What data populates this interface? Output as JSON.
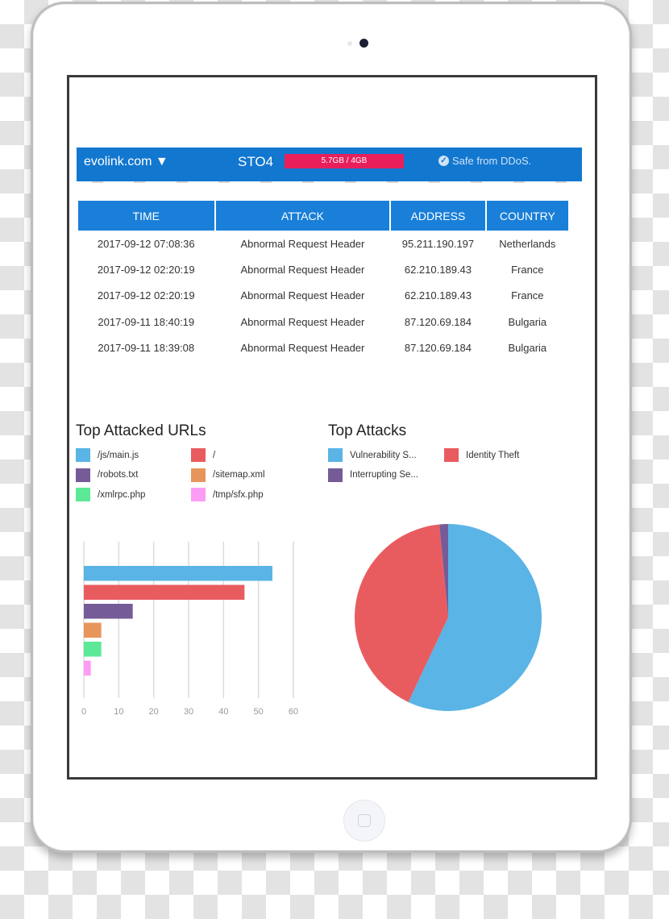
{
  "header": {
    "domain": "evolink.com ▼",
    "server": "STO4",
    "usage": "5.7GB / 4GB",
    "usage_fraction": 1.425,
    "status": "Safe from DDoS.",
    "status_icon": "check-circle-icon"
  },
  "attack_table": {
    "columns": [
      "TIME",
      "ATTACK",
      "ADDRESS",
      "COUNTRY"
    ],
    "rows": [
      [
        "2017-09-12 07:08:36",
        "Abnormal Request Header",
        "95.211.190.197",
        "Netherlands"
      ],
      [
        "2017-09-12 02:20:19",
        "Abnormal Request Header",
        "62.210.189.43",
        "France"
      ],
      [
        "2017-09-12 02:20:19",
        "Abnormal Request Header",
        "62.210.189.43",
        "France"
      ],
      [
        "2017-09-11 18:40:19",
        "Abnormal Request Header",
        "87.120.69.184",
        "Bulgaria"
      ],
      [
        "2017-09-11 18:39:08",
        "Abnormal Request Header",
        "87.120.69.184",
        "Bulgaria"
      ]
    ]
  },
  "colors": {
    "header_bg": "#1277cf",
    "table_header_bg": "#1a7fd8",
    "usage_bar": "#e81f5b"
  },
  "chart_data": [
    {
      "type": "bar",
      "orientation": "horizontal",
      "title": "Top Attacked URLs",
      "categories": [
        "/js/main.js",
        "/",
        "/robots.txt",
        "/sitemap.xml",
        "/xmlrpc.php",
        "/tmp/sfx.php"
      ],
      "values": [
        54,
        46,
        14,
        5,
        5,
        2
      ],
      "colors": [
        "#5ab4e5",
        "#e85c60",
        "#755c98",
        "#e8955c",
        "#5ce896",
        "#fd9cf5"
      ],
      "xlim": [
        0,
        60
      ],
      "xticks": [
        "0",
        "10",
        "20",
        "30",
        "40",
        "50",
        "60"
      ],
      "grid": true,
      "legend": "top"
    },
    {
      "type": "pie",
      "title": "Top Attacks",
      "labels": [
        "Vulnerability S...",
        "Identity Theft",
        "Interrupting Se..."
      ],
      "values": [
        57,
        41.5,
        1.5
      ],
      "colors": [
        "#5ab4e5",
        "#e85c60",
        "#755c98"
      ],
      "legend": "top"
    }
  ]
}
